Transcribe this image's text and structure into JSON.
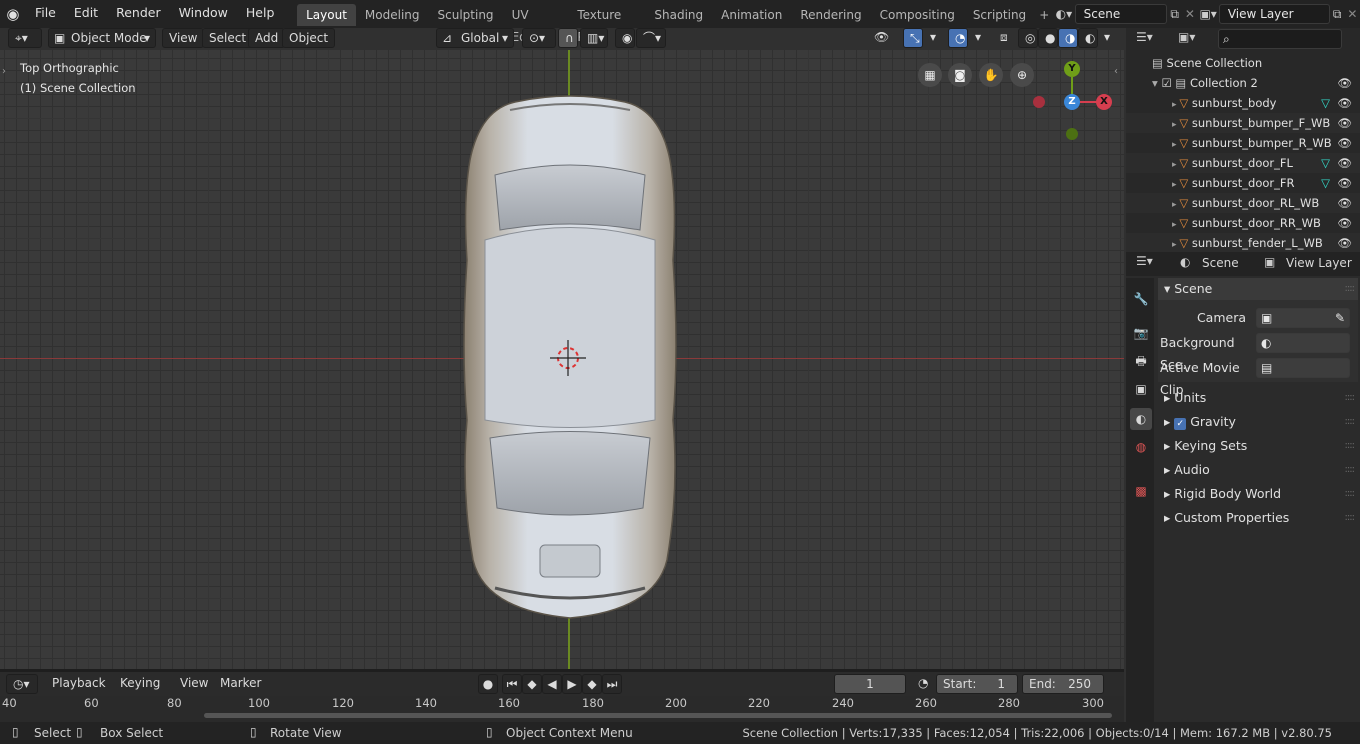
{
  "topbar": {
    "menus": [
      "File",
      "Edit",
      "Render",
      "Window",
      "Help"
    ],
    "workspaces": [
      "Layout",
      "Modeling",
      "Sculpting",
      "UV Editing",
      "Texture Paint",
      "Shading",
      "Animation",
      "Rendering",
      "Compositing",
      "Scripting"
    ],
    "active_workspace": "Layout",
    "add_tab": "+",
    "scene_label": "Scene",
    "view_layer_label": "View Layer"
  },
  "viewport_header": {
    "mode": "Object Mode",
    "menus": [
      "View",
      "Select",
      "Add",
      "Object"
    ],
    "orientation": "Global"
  },
  "viewport": {
    "view_name": "Top Orthographic",
    "collection_label": "(1) Scene Collection",
    "gizmo": {
      "y": "Y",
      "z": "Z",
      "x": "X"
    }
  },
  "outliner": {
    "root": "Scene Collection",
    "collection": "Collection 2",
    "objects": [
      "sunburst_body",
      "sunburst_bumper_F_WB",
      "sunburst_bumper_R_WB",
      "sunburst_door_FL",
      "sunburst_door_FR",
      "sunburst_door_RL_WB",
      "sunburst_door_RR_WB",
      "sunburst_fender_L_WB"
    ]
  },
  "properties": {
    "header_scene": "Scene",
    "header_view_layer": "View Layer",
    "panel_title": "Scene",
    "camera_label": "Camera",
    "background_label": "Background Sce..",
    "movie_clip_label": "Active Movie Clip",
    "sections": [
      "Units",
      "Gravity",
      "Keying Sets",
      "Audio",
      "Rigid Body World",
      "Custom Properties"
    ]
  },
  "timeline": {
    "menus": [
      "Playback",
      "Keying",
      "View",
      "Marker"
    ],
    "current_frame": "1",
    "start_label": "Start:",
    "start_value": "1",
    "end_label": "End:",
    "end_value": "250",
    "ticks": [
      "40",
      "60",
      "80",
      "100",
      "120",
      "140",
      "160",
      "180",
      "200",
      "220",
      "240",
      "260",
      "280",
      "300"
    ]
  },
  "statusbar": {
    "select": "Select",
    "box_select": "Box Select",
    "rotate_view": "Rotate View",
    "context_menu": "Object Context Menu",
    "stats": "Scene Collection | Verts:17,335 | Faces:12,054 | Tris:22,006 | Objects:0/14 | Mem: 167.2 MB | v2.80.75"
  },
  "colors": {
    "accent": "#4772b3",
    "x_axis": "#d53e4f",
    "y_axis": "#6f9e18",
    "z_axis": "#3a87d8",
    "mesh_icon": "#e08a3c"
  }
}
